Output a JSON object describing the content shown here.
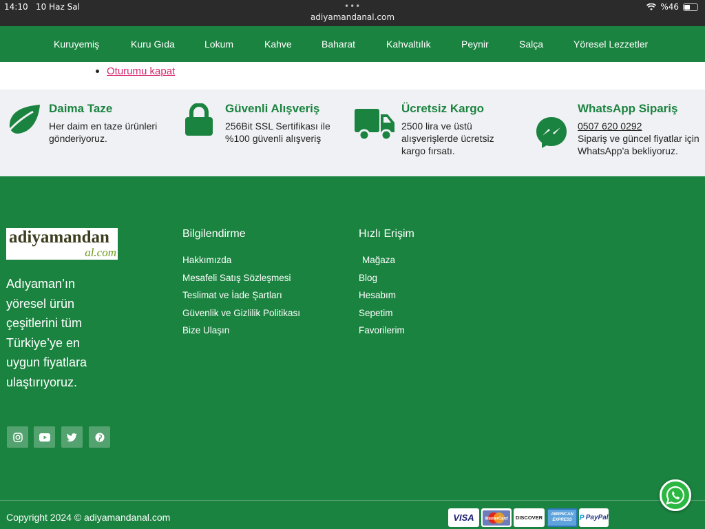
{
  "status": {
    "time": "14:10",
    "date": "10 Haz Sal",
    "url": "adiyamandanal.com",
    "battery": "%46"
  },
  "nav": [
    "Kuruyemiş",
    "Kuru Gıda",
    "Lokum",
    "Kahve",
    "Baharat",
    "Kahvaltılık",
    "Peynir",
    "Salça",
    "Yöresel Lezzetler"
  ],
  "account": {
    "logout_link": "Oturumu kapat"
  },
  "features": [
    {
      "title": "Daima Taze",
      "text": "Her daim en taze ürünleri gönderiyoruz.",
      "icon": "leaf-icon"
    },
    {
      "title": "Güvenli Alışveriş",
      "text": "256Bit SSL Sertifikası ile %100 güvenli alışveriş",
      "icon": "lock-icon"
    },
    {
      "title": "Ücretsiz Kargo",
      "text": "2500 lira ve üstü alışverişlerde ücretsiz kargo fırsatı.",
      "icon": "truck-icon"
    },
    {
      "title": "WhatsApp Sipariş",
      "phone": "0507 620 0292",
      "text": "Sipariş ve güncel fiyatlar için WhatsApp'a bekliyoruz.",
      "icon": "messenger-icon"
    }
  ],
  "footer": {
    "logo_line1": "adiyamandan",
    "logo_line2": "al.com",
    "about": "Adıyaman’ın yöresel ürün çeşitlerini tüm Türkiye’ye en uygun fiyatlara ulaştırıyoruz.",
    "info_title": "Bilgilendirme",
    "info_links": [
      "Hakkımızda",
      "Mesafeli Satış Sözleşmesi",
      "Teslimat ve İade Şartları",
      "Güvenlik ve Gizlilik Politikası",
      "Bize Ulaşın"
    ],
    "quick_title": "Hızlı Erişim",
    "quick_links": [
      "Mağaza",
      "Blog",
      "Hesabım",
      "Sepetim",
      "Favorilerim"
    ],
    "social": [
      "instagram-icon",
      "youtube-icon",
      "twitter-icon",
      "pinterest-icon"
    ],
    "copyright": "Copyright 2024 © adiyamandanal.com",
    "cards": [
      "VISA",
      "MasterCard",
      "DISCOVER",
      "AMERICAN EXPRESS",
      "PayPal"
    ]
  },
  "colors": {
    "brand_green": "#1b8340",
    "link_pink": "#d6246e",
    "feature_bg": "#f0f1f4"
  }
}
